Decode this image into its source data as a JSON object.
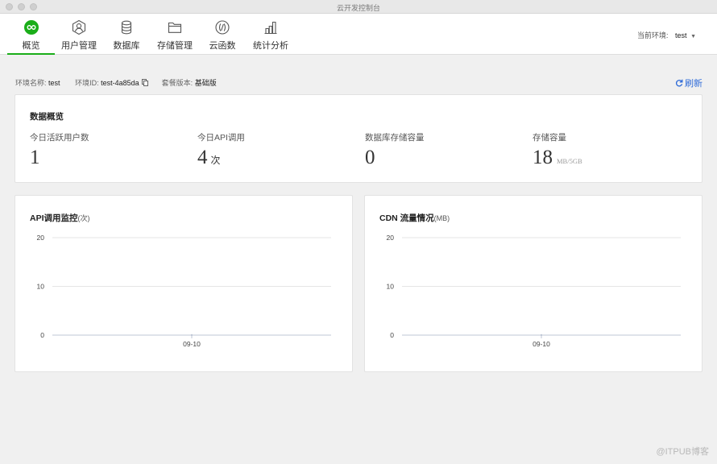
{
  "window": {
    "title": "云开发控制台"
  },
  "nav": {
    "items": [
      {
        "label": "概览",
        "icon": "infinity-icon",
        "active": true
      },
      {
        "label": "用户管理",
        "icon": "users-icon",
        "active": false
      },
      {
        "label": "数据库",
        "icon": "database-icon",
        "active": false
      },
      {
        "label": "存储管理",
        "icon": "folder-icon",
        "active": false
      },
      {
        "label": "云函数",
        "icon": "function-icon",
        "active": false
      },
      {
        "label": "统计分析",
        "icon": "stats-icon",
        "active": false
      }
    ],
    "env_label": "当前环境:",
    "env_value": "test",
    "accent": "#1aad19"
  },
  "env_info": {
    "name_label": "环境名称:",
    "name_value": "test",
    "id_label": "环境ID:",
    "id_value": "test-4a85da",
    "plan_label": "套餐版本:",
    "plan_value": "基础版",
    "refresh_label": "刷新"
  },
  "overview": {
    "title": "数据概览",
    "stats": [
      {
        "label": "今日活跃用户数",
        "value": "1",
        "unit": "",
        "unit_small": ""
      },
      {
        "label": "今日API调用",
        "value": "4",
        "unit": "次",
        "unit_small": ""
      },
      {
        "label": "数据库存储容量",
        "value": "0",
        "unit": "",
        "unit_small": ""
      },
      {
        "label": "存储容量",
        "value": "18",
        "unit": "",
        "unit_small": "MB/5GB"
      }
    ]
  },
  "chart_data": [
    {
      "type": "line",
      "title": "API调用监控",
      "title_unit": "(次)",
      "x": [
        "09-10"
      ],
      "series": [
        {
          "values": [
            0
          ]
        }
      ],
      "ylim": [
        0,
        20
      ],
      "yticks": [
        "20",
        "10",
        "0"
      ],
      "grid": true
    },
    {
      "type": "line",
      "title": "CDN 流量情况",
      "title_unit": "(MB)",
      "x": [
        "09-10"
      ],
      "series": [
        {
          "values": [
            0
          ]
        }
      ],
      "ylim": [
        0,
        20
      ],
      "yticks": [
        "20",
        "10",
        "0"
      ],
      "grid": true
    }
  ],
  "watermark": "@ITPUB博客"
}
